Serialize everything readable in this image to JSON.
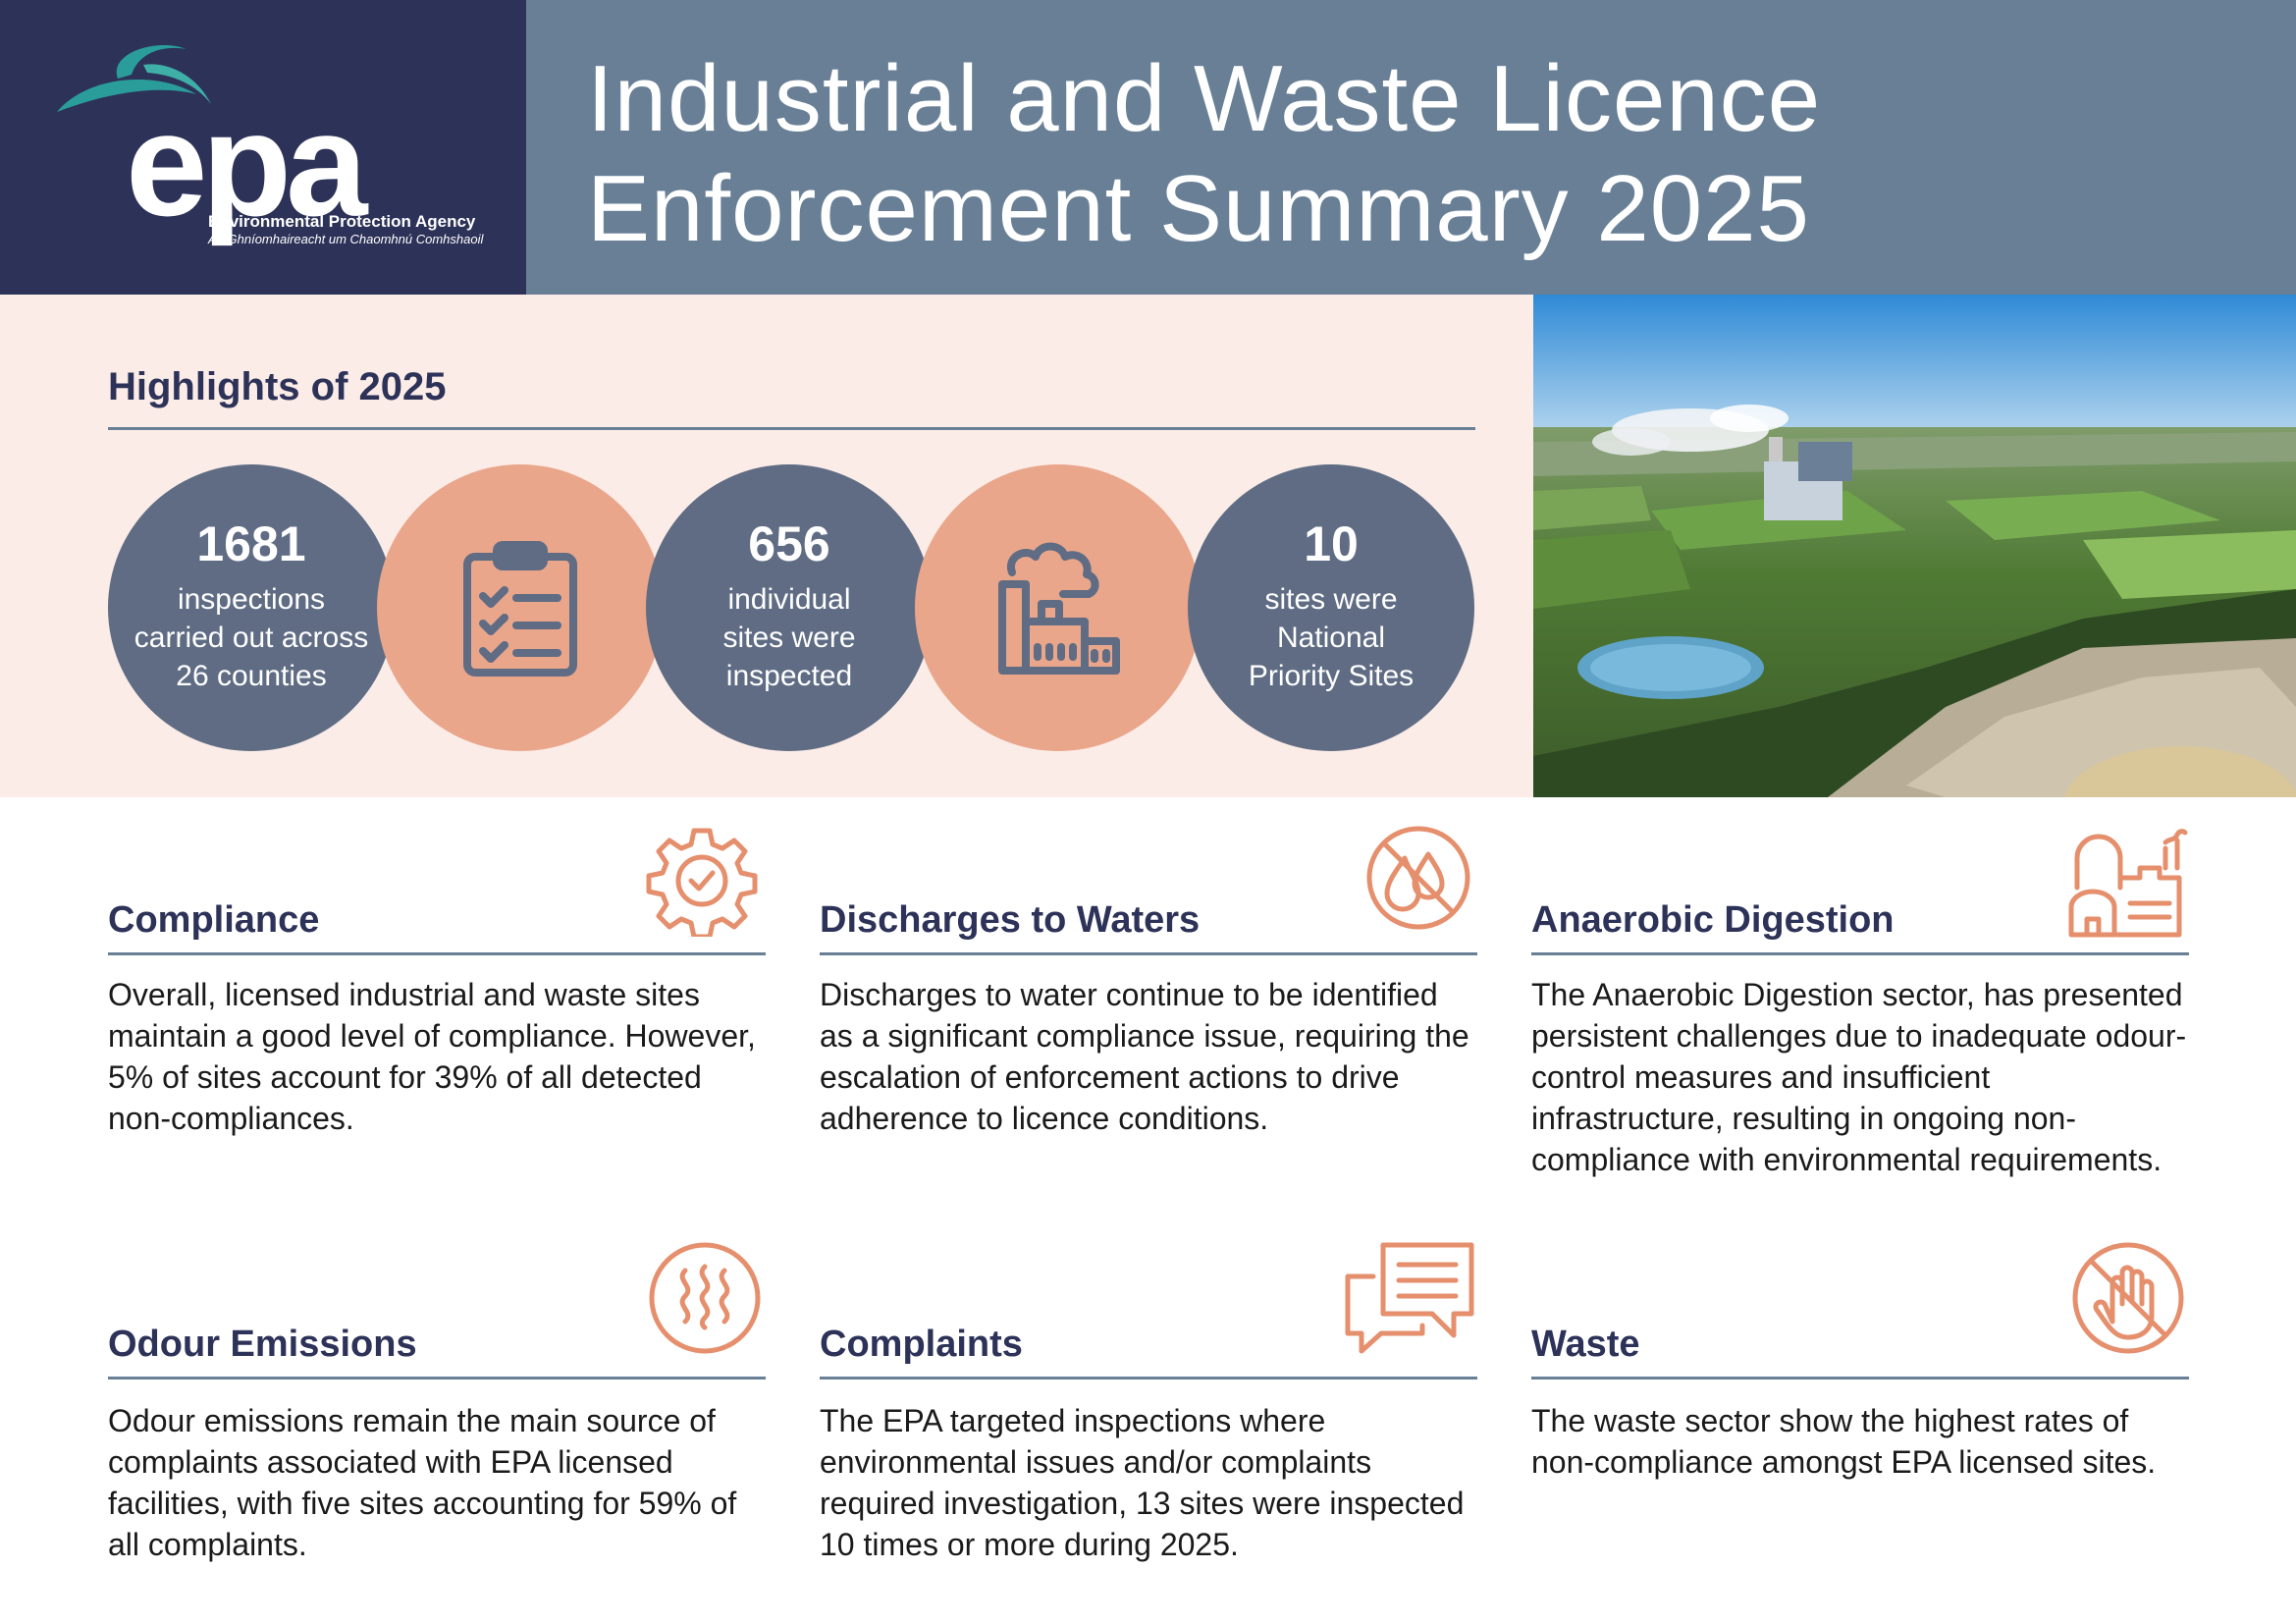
{
  "header": {
    "title_line1": "Industrial and Waste Licence",
    "title_line2": "Enforcement Summary 2025",
    "logo": {
      "word": "epa",
      "subtitle_en": "Environmental Protection Agency",
      "subtitle_ga": "An Ghníomhaireacht um Chaomhnú Comhshaoil"
    }
  },
  "highlights": {
    "title": "Highlights of 2025",
    "stats": [
      {
        "value": "1681",
        "line1": "inspections",
        "line2": "carried out across",
        "line3": "26 counties"
      },
      {
        "value": "656",
        "line1": "individual",
        "line2": "sites were",
        "line3": "inspected"
      },
      {
        "value": "10",
        "line1": "sites were",
        "line2": "National",
        "line3": "Priority Sites"
      }
    ],
    "icons": [
      "clipboard-checklist-icon",
      "factory-icon"
    ]
  },
  "cards": [
    {
      "title": "Compliance",
      "icon": "gear-check-icon",
      "text": "Overall, licensed industrial and waste sites maintain a good level of compliance. However, 5% of sites account for 39% of all detected non-compliances."
    },
    {
      "title": "Discharges to Waters",
      "icon": "no-water-drop-icon",
      "text": "Discharges to water continue to be identified as a significant compliance issue, requiring the escalation of enforcement actions to drive adherence to licence conditions."
    },
    {
      "title": "Anaerobic Digestion",
      "icon": "digester-plant-icon",
      "text": "The Anaerobic Digestion sector, has presented persistent challenges due to inadequate odour-control measures and insufficient infrastructure, resulting in ongoing non-compliance with environmental requirements."
    },
    {
      "title": "Odour Emissions",
      "icon": "odour-waves-icon",
      "text": "Odour emissions remain the main source of complaints associated with EPA licensed facilities, with five sites accounting for 59% of all complaints."
    },
    {
      "title": "Complaints",
      "icon": "speech-bubbles-icon",
      "text": "The EPA targeted inspections where environmental issues and/or complaints required investigation, 13 sites were inspected 10 times or more during 2025."
    },
    {
      "title": "Waste",
      "icon": "no-hand-icon",
      "text": "The waste sector show the highest rates of non-compliance amongst EPA licensed sites."
    }
  ],
  "colors": {
    "navy": "#2d3258",
    "slate": "#687f96",
    "circle_slate": "#5f6c84",
    "peach": "#e9a68b",
    "icon_orange": "#e58f6d",
    "highlight_bg": "#fbece7"
  }
}
